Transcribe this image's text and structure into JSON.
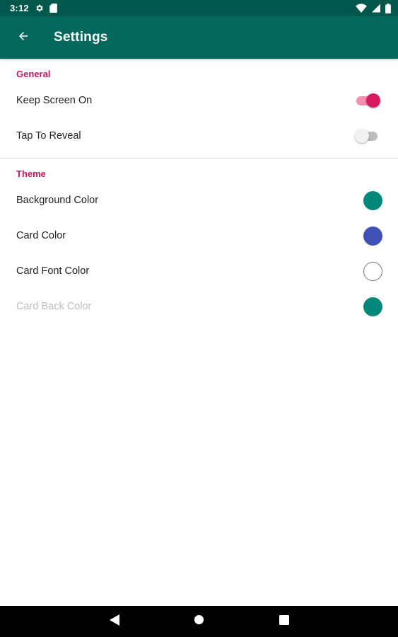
{
  "status_bar": {
    "time": "3:12",
    "icons": [
      "gear-icon",
      "sd-card-icon",
      "wifi-icon",
      "signal-icon",
      "battery-icon"
    ]
  },
  "app_bar": {
    "title": "Settings",
    "back_icon": "arrow-back-icon",
    "color": "#00695c"
  },
  "sections": {
    "general": {
      "header": "General",
      "keep_screen_on": {
        "label": "Keep Screen On",
        "enabled": true
      },
      "tap_to_reveal": {
        "label": "Tap To Reveal",
        "enabled": false
      }
    },
    "theme": {
      "header": "Theme",
      "background_color": {
        "label": "Background Color",
        "color": "#00897b"
      },
      "card_color": {
        "label": "Card Color",
        "color": "#3f51b5"
      },
      "card_font_color": {
        "label": "Card Font Color",
        "color": "#ffffff"
      },
      "card_back_color": {
        "label": "Card Back Color",
        "color": "#00897b",
        "disabled": true
      }
    }
  },
  "accent_color": "#c2185b",
  "nav_bar": {
    "icons": [
      "back-triangle-icon",
      "home-circle-icon",
      "recents-square-icon"
    ]
  }
}
